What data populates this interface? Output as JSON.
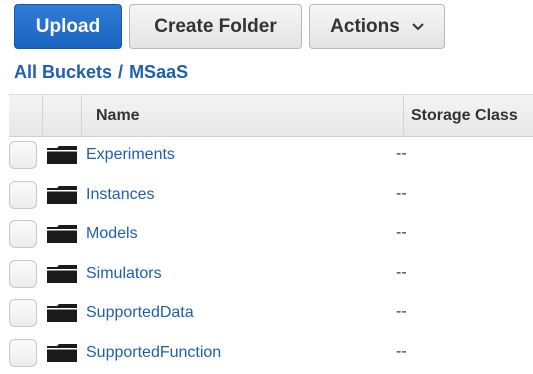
{
  "toolbar": {
    "upload_label": "Upload",
    "create_folder_label": "Create Folder",
    "actions_label": "Actions"
  },
  "breadcrumb": {
    "root": "All Buckets",
    "separator": "/",
    "current": "MSaaS"
  },
  "table": {
    "columns": [
      "Name",
      "Storage Class"
    ],
    "rows": [
      {
        "name": "Experiments",
        "storage_class": "--"
      },
      {
        "name": "Instances",
        "storage_class": "--"
      },
      {
        "name": "Models",
        "storage_class": "--"
      },
      {
        "name": "Simulators",
        "storage_class": "--"
      },
      {
        "name": "SupportedData",
        "storage_class": "--"
      },
      {
        "name": "SupportedFunction",
        "storage_class": "--"
      }
    ]
  },
  "icons": {
    "row_icon": "folder-icon",
    "actions_icon": "chevron-down-icon"
  },
  "colors": {
    "primary": "#1b64c0",
    "link": "#1f5fb2"
  }
}
